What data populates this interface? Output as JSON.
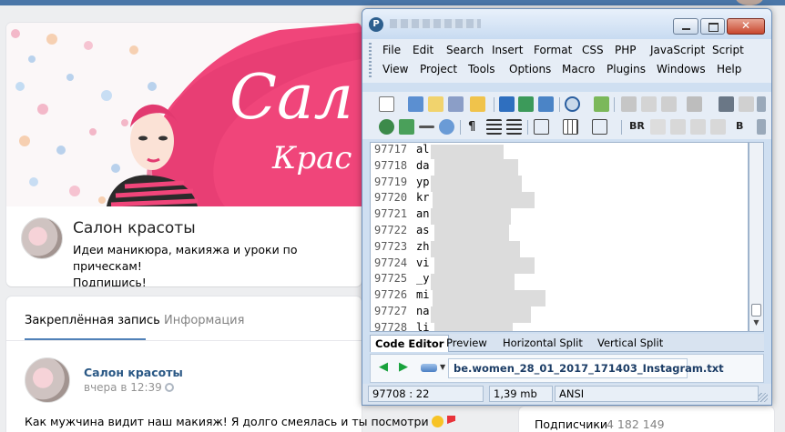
{
  "community": {
    "name": "Салон красоты",
    "description_line1": "Идеи маникюра, макияжа и уроки по прическам!",
    "description_line2": "Подпишись!",
    "cover_text_big": "Сал",
    "cover_text_small": "Крас"
  },
  "feed": {
    "tab_pinned": "Закреплённая запись",
    "tab_info": "Информация",
    "post": {
      "author": "Салон красоты",
      "time": "вчера в 12:39",
      "text": "Как мужчина видит наш макияж! Я долго смеялась и ты посмотри"
    }
  },
  "sidebar": {
    "followers_label": "Подписчики",
    "followers_count": "4 182 149"
  },
  "editor": {
    "app_icon_letter": "P",
    "menu": [
      "File",
      "Edit",
      "Search",
      "Insert",
      "Format",
      "CSS",
      "PHP",
      "JavaScript",
      "Script",
      "View",
      "Project",
      "Tools",
      "Options",
      "Macro",
      "Plugins",
      "Windows",
      "Help"
    ],
    "toolbar_text_bold": "BR",
    "toolbar_text_b": "B",
    "lines": [
      {
        "no": "97717",
        "text": "al"
      },
      {
        "no": "97718",
        "text": "da"
      },
      {
        "no": "97719",
        "text": "yp"
      },
      {
        "no": "97720",
        "text": "kr"
      },
      {
        "no": "97721",
        "text": "an"
      },
      {
        "no": "97722",
        "text": "as"
      },
      {
        "no": "97723",
        "text": "zh"
      },
      {
        "no": "97724",
        "text": "vi"
      },
      {
        "no": "97725",
        "text": "_y"
      },
      {
        "no": "97726",
        "text": "mi"
      },
      {
        "no": "97727",
        "text": "na"
      },
      {
        "no": "97728",
        "text": "li"
      }
    ],
    "tabs": [
      "Code Editor",
      "Preview",
      "Horizontal Split",
      "Vertical Split"
    ],
    "file_name": "be.women_28_01_2017_171403_Instagram.txt",
    "status_position": "97708 : 22",
    "status_size": "1,39 mb",
    "status_encoding": "ANSI"
  },
  "colors": {
    "vk_blue": "#4a76a8",
    "link": "#2a5885",
    "cover_pink": "#f0457a"
  }
}
